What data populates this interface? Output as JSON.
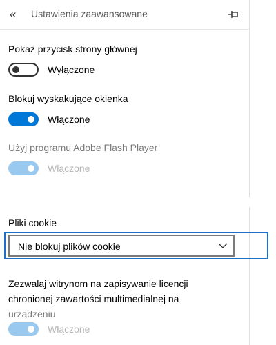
{
  "header": {
    "title": "Ustawienia zaawansowane",
    "back_icon": "double-chevron-left-icon",
    "pin_icon": "pin-icon"
  },
  "settings": {
    "home_button": {
      "label": "Pokaż przycisk strony głównej",
      "state": "Wyłączone",
      "on": false
    },
    "popups": {
      "label": "Blokuj wyskakujące okienka",
      "state": "Włączone",
      "on": true
    },
    "flash": {
      "label": "Użyj programu Adobe Flash Player",
      "state": "Włączone",
      "on": true,
      "disabled": true
    },
    "cookies": {
      "label": "Pliki cookie",
      "selected": "Nie blokuj plików cookie"
    },
    "media_licenses": {
      "label_line1": "Zezwalaj witrynom na zapisywanie licencji",
      "label_line2": "chronionej zawartości multimedialnej na",
      "label_line3": "urządzeniu",
      "state": "Włączone",
      "on": true,
      "disabled": true
    }
  },
  "colors": {
    "accent": "#0078d7",
    "accent_dim": "#99c9ef",
    "focus": "#1e6fc8"
  }
}
